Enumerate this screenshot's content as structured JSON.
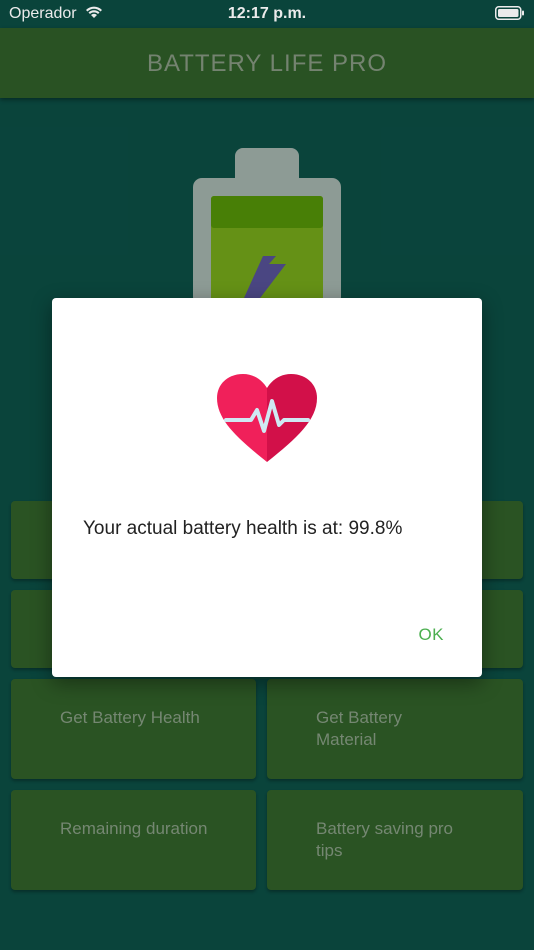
{
  "status_bar": {
    "carrier": "Operador",
    "time": "12:17 p.m.",
    "wifi_icon": "wifi-icon",
    "battery_icon": "battery-icon"
  },
  "app_bar": {
    "title": "BATTERY LIFE PRO"
  },
  "hero": {
    "icon": "charging-battery-icon"
  },
  "tiles": [
    {
      "label": ""
    },
    {
      "label": ""
    },
    {
      "label": ""
    },
    {
      "label": ""
    },
    {
      "label": "Get Battery Health"
    },
    {
      "label": "Get Battery Material"
    },
    {
      "label": "Remaining duration"
    },
    {
      "label": "Battery saving pro tips"
    }
  ],
  "dialog": {
    "icon": "heart-pulse-icon",
    "message": "Your actual battery health is at: 99.8%",
    "ok_label": "OK"
  },
  "colors": {
    "background": "#0b4a41",
    "app_bar": "#2d5a26",
    "tile": "#2e5b27",
    "accent": "#4caf50",
    "heart": "#f0205a"
  }
}
